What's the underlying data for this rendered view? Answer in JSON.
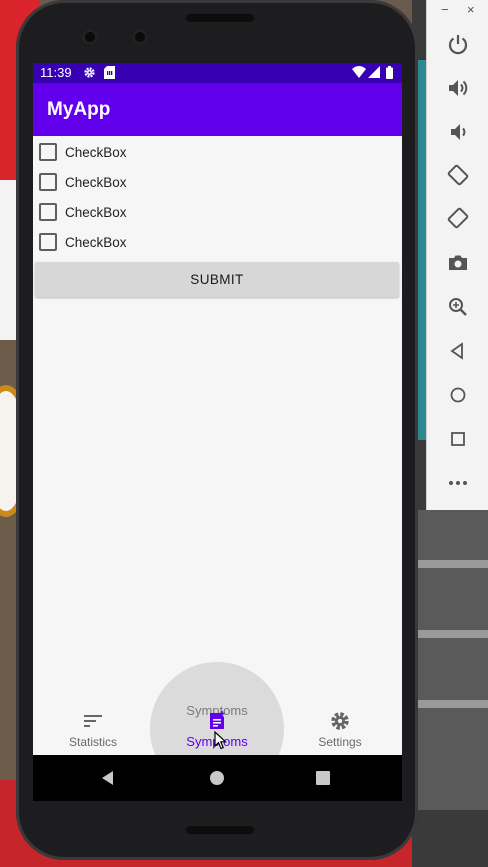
{
  "status_bar": {
    "time": "11:39",
    "icons": [
      "settings-icon",
      "sim-card-icon",
      "wifi-icon",
      "signal-icon",
      "battery-icon"
    ]
  },
  "app": {
    "title": "MyApp",
    "checkboxes": [
      {
        "label": "CheckBox",
        "checked": false
      },
      {
        "label": "CheckBox",
        "checked": false
      },
      {
        "label": "CheckBox",
        "checked": false
      },
      {
        "label": "CheckBox",
        "checked": false
      }
    ],
    "submit_label": "SUBMIT"
  },
  "bottom_nav": {
    "items": [
      {
        "label": "Statistics",
        "icon": "sort-lines-icon",
        "active": false
      },
      {
        "label": "Symptoms",
        "icon": "note-add-icon",
        "active": true
      },
      {
        "label": "Settings",
        "icon": "gear-icon",
        "active": false
      }
    ],
    "tooltip": "Symptoms"
  },
  "system_nav": {
    "buttons": [
      "back-triangle-icon",
      "home-circle-icon",
      "recents-square-icon"
    ]
  },
  "emulator_toolbar": {
    "window_controls": [
      "minimize",
      "close"
    ],
    "minimize_glyph": "−",
    "close_glyph": "×",
    "buttons": [
      "power",
      "volume-up",
      "volume-down",
      "rotate-left",
      "rotate-right",
      "screenshot",
      "zoom",
      "back",
      "home",
      "overview",
      "more"
    ]
  },
  "colors": {
    "primary": "#6200ee",
    "primary_dark": "#3700b3",
    "screen_background": "#f6f6f6",
    "button_gray": "#d7d7d7"
  }
}
